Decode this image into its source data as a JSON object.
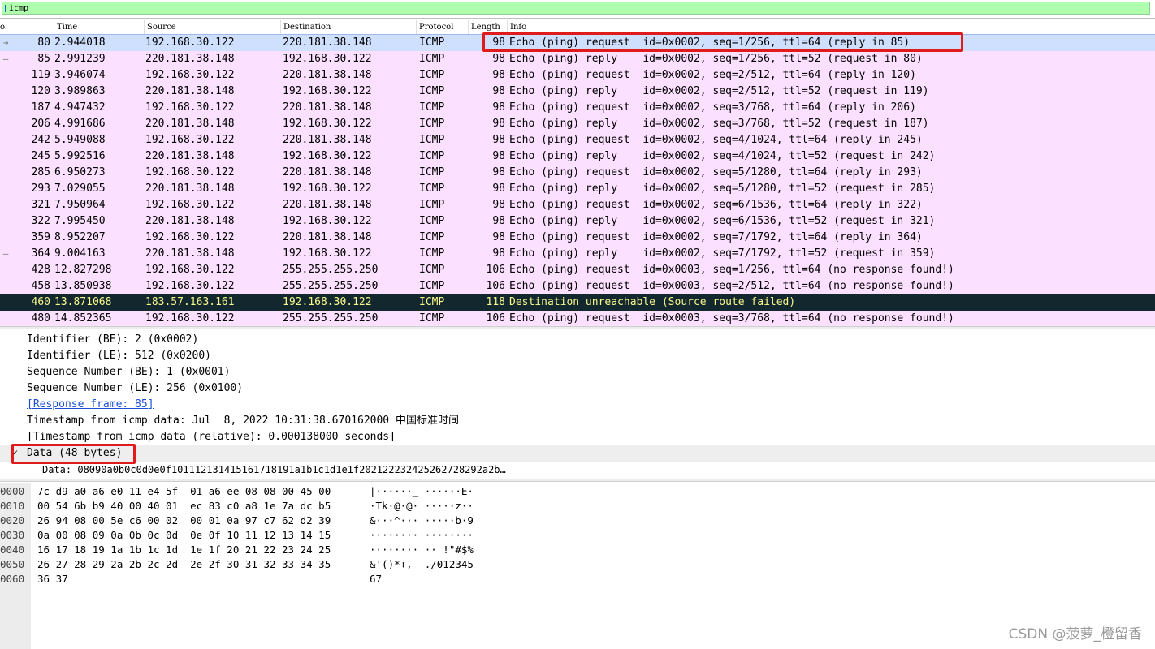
{
  "filter": {
    "value": "icmp"
  },
  "columns": {
    "no": "o.",
    "time": "Time",
    "source": "Source",
    "destination": "Destination",
    "protocol": "Protocol",
    "length": "Length",
    "info": "Info"
  },
  "packets": [
    {
      "mark": "→",
      "no": "80",
      "time": "2.944018",
      "src": "192.168.30.122",
      "dst": "220.181.38.148",
      "proto": "ICMP",
      "len": "98",
      "info": "Echo (ping) request  id=0x0002, seq=1/256, ttl=64 (reply in 85)",
      "state": "sel"
    },
    {
      "mark": "—",
      "no": "85",
      "time": "2.991239",
      "src": "220.181.38.148",
      "dst": "192.168.30.122",
      "proto": "ICMP",
      "len": "98",
      "info": "Echo (ping) reply    id=0x0002, seq=1/256, ttl=52 (request in 80)",
      "state": ""
    },
    {
      "mark": "",
      "no": "119",
      "time": "3.946074",
      "src": "192.168.30.122",
      "dst": "220.181.38.148",
      "proto": "ICMP",
      "len": "98",
      "info": "Echo (ping) request  id=0x0002, seq=2/512, ttl=64 (reply in 120)",
      "state": ""
    },
    {
      "mark": "",
      "no": "120",
      "time": "3.989863",
      "src": "220.181.38.148",
      "dst": "192.168.30.122",
      "proto": "ICMP",
      "len": "98",
      "info": "Echo (ping) reply    id=0x0002, seq=2/512, ttl=52 (request in 119)",
      "state": ""
    },
    {
      "mark": "",
      "no": "187",
      "time": "4.947432",
      "src": "192.168.30.122",
      "dst": "220.181.38.148",
      "proto": "ICMP",
      "len": "98",
      "info": "Echo (ping) request  id=0x0002, seq=3/768, ttl=64 (reply in 206)",
      "state": ""
    },
    {
      "mark": "",
      "no": "206",
      "time": "4.991686",
      "src": "220.181.38.148",
      "dst": "192.168.30.122",
      "proto": "ICMP",
      "len": "98",
      "info": "Echo (ping) reply    id=0x0002, seq=3/768, ttl=52 (request in 187)",
      "state": ""
    },
    {
      "mark": "",
      "no": "242",
      "time": "5.949088",
      "src": "192.168.30.122",
      "dst": "220.181.38.148",
      "proto": "ICMP",
      "len": "98",
      "info": "Echo (ping) request  id=0x0002, seq=4/1024, ttl=64 (reply in 245)",
      "state": ""
    },
    {
      "mark": "",
      "no": "245",
      "time": "5.992516",
      "src": "220.181.38.148",
      "dst": "192.168.30.122",
      "proto": "ICMP",
      "len": "98",
      "info": "Echo (ping) reply    id=0x0002, seq=4/1024, ttl=52 (request in 242)",
      "state": ""
    },
    {
      "mark": "",
      "no": "285",
      "time": "6.950273",
      "src": "192.168.30.122",
      "dst": "220.181.38.148",
      "proto": "ICMP",
      "len": "98",
      "info": "Echo (ping) request  id=0x0002, seq=5/1280, ttl=64 (reply in 293)",
      "state": ""
    },
    {
      "mark": "",
      "no": "293",
      "time": "7.029055",
      "src": "220.181.38.148",
      "dst": "192.168.30.122",
      "proto": "ICMP",
      "len": "98",
      "info": "Echo (ping) reply    id=0x0002, seq=5/1280, ttl=52 (request in 285)",
      "state": ""
    },
    {
      "mark": "",
      "no": "321",
      "time": "7.950964",
      "src": "192.168.30.122",
      "dst": "220.181.38.148",
      "proto": "ICMP",
      "len": "98",
      "info": "Echo (ping) request  id=0x0002, seq=6/1536, ttl=64 (reply in 322)",
      "state": ""
    },
    {
      "mark": "",
      "no": "322",
      "time": "7.995450",
      "src": "220.181.38.148",
      "dst": "192.168.30.122",
      "proto": "ICMP",
      "len": "98",
      "info": "Echo (ping) reply    id=0x0002, seq=6/1536, ttl=52 (request in 321)",
      "state": ""
    },
    {
      "mark": "",
      "no": "359",
      "time": "8.952207",
      "src": "192.168.30.122",
      "dst": "220.181.38.148",
      "proto": "ICMP",
      "len": "98",
      "info": "Echo (ping) request  id=0x0002, seq=7/1792, ttl=64 (reply in 364)",
      "state": ""
    },
    {
      "mark": "—",
      "no": "364",
      "time": "9.004163",
      "src": "220.181.38.148",
      "dst": "192.168.30.122",
      "proto": "ICMP",
      "len": "98",
      "info": "Echo (ping) reply    id=0x0002, seq=7/1792, ttl=52 (request in 359)",
      "state": ""
    },
    {
      "mark": "",
      "no": "428",
      "time": "12.827298",
      "src": "192.168.30.122",
      "dst": "255.255.255.250",
      "proto": "ICMP",
      "len": "106",
      "info": "Echo (ping) request  id=0x0003, seq=1/256, ttl=64 (no response found!)",
      "state": ""
    },
    {
      "mark": "",
      "no": "458",
      "time": "13.850938",
      "src": "192.168.30.122",
      "dst": "255.255.255.250",
      "proto": "ICMP",
      "len": "106",
      "info": "Echo (ping) request  id=0x0003, seq=2/512, ttl=64 (no response found!)",
      "state": ""
    },
    {
      "mark": "",
      "no": "460",
      "time": "13.871068",
      "src": "183.57.163.161",
      "dst": "192.168.30.122",
      "proto": "ICMP",
      "len": "118",
      "info": "Destination unreachable (Source route failed)",
      "state": "err"
    },
    {
      "mark": "",
      "no": "480",
      "time": "14.852365",
      "src": "192.168.30.122",
      "dst": "255.255.255.250",
      "proto": "ICMP",
      "len": "106",
      "info": "Echo (ping) request  id=0x0003, seq=3/768, ttl=64 (no response found!)",
      "state": ""
    }
  ],
  "details": [
    {
      "text": "Identifier (BE): 2 (0x0002)",
      "kind": "plain"
    },
    {
      "text": "Identifier (LE): 512 (0x0200)",
      "kind": "plain"
    },
    {
      "text": "Sequence Number (BE): 1 (0x0001)",
      "kind": "plain"
    },
    {
      "text": "Sequence Number (LE): 256 (0x0100)",
      "kind": "plain"
    },
    {
      "text": "[Response frame: 85]",
      "kind": "link"
    },
    {
      "text": "Timestamp from icmp data: Jul  8, 2022 10:31:38.670162000 中国标准时间",
      "kind": "plain"
    },
    {
      "text": "[Timestamp from icmp data (relative): 0.000138000 seconds]",
      "kind": "plain"
    },
    {
      "text": "Data (48 bytes)",
      "kind": "expanded",
      "arrow": "✓"
    },
    {
      "text": "Data: 08090a0b0c0d0e0f101112131415161718191a1b1c1d1e1f202122232425262728292a2b…",
      "kind": "sub"
    }
  ],
  "bytes": [
    {
      "off": "0000",
      "hex": "7c d9 a0 a6 e0 11 e4 5f  01 a6 ee 08 08 00 45 00",
      "ascii": "|······_ ······E·"
    },
    {
      "off": "0010",
      "hex": "00 54 6b b9 40 00 40 01  ec 83 c0 a8 1e 7a dc b5",
      "ascii": "·Tk·@·@· ·····z··"
    },
    {
      "off": "0020",
      "hex": "26 94 08 00 5e c6 00 02  00 01 0a 97 c7 62 d2 39",
      "ascii": "&···^··· ·····b·9"
    },
    {
      "off": "0030",
      "hex": "0a 00 08 09 0a 0b 0c 0d  0e 0f 10 11 12 13 14 15",
      "ascii": "········ ········"
    },
    {
      "off": "0040",
      "hex": "16 17 18 19 1a 1b 1c 1d  1e 1f 20 21 22 23 24 25",
      "ascii": "········ ·· !\"#$%"
    },
    {
      "off": "0050",
      "hex": "26 27 28 29 2a 2b 2c 2d  2e 2f 30 31 32 33 34 35",
      "ascii": "&'()*+,- ./012345"
    },
    {
      "off": "0060",
      "hex": "36 37",
      "ascii": "67"
    }
  ],
  "watermark": "CSDN @菠萝_橙留香",
  "colors": {
    "filter_bg": "#afffaf",
    "row_bg": "#fce0ff",
    "selected_bg": "#cfe0ff",
    "error_bg": "#12272e",
    "error_fg": "#f7f78a",
    "highlight": "#e01b1b"
  }
}
